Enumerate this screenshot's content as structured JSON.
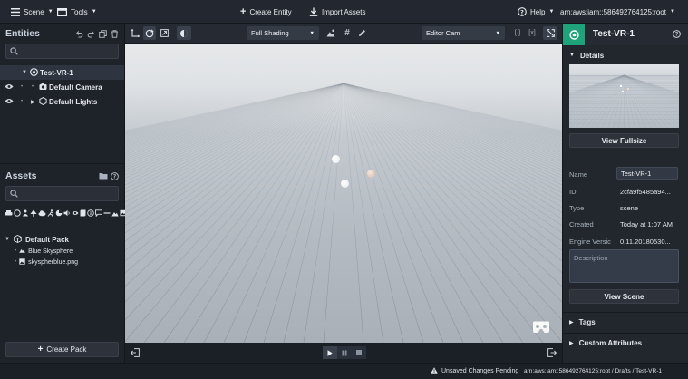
{
  "topbar": {
    "scene_menu": "Scene",
    "tools_menu": "Tools",
    "create_entity": "Create Entity",
    "import_assets": "Import Assets",
    "help_menu": "Help",
    "account_menu": "arn:aws:iam::586492764125:root"
  },
  "entities": {
    "title": "Entities",
    "search_placeholder": "",
    "tree": [
      {
        "label": "Test-VR-1"
      },
      {
        "label": "Default Camera"
      },
      {
        "label": "Default Lights"
      }
    ]
  },
  "assets": {
    "title": "Assets",
    "search_placeholder": "",
    "pack": "Default Pack",
    "items": [
      "Blue Skysphere",
      "skyspherblue.png"
    ],
    "create_pack": "Create Pack"
  },
  "viewport_toolbar": {
    "shading": "Full Shading",
    "camera": "Editor Cam"
  },
  "details": {
    "panel_title": "Test-VR-1",
    "section_title": "Details",
    "view_fullsize": "View Fullsize",
    "fields": [
      {
        "label": "Name",
        "value": "Test-VR-1"
      },
      {
        "label": "ID",
        "value": "2cfa9f5485a94..."
      },
      {
        "label": "Type",
        "value": "scene"
      },
      {
        "label": "Created",
        "value": "Today at 1:07 AM"
      },
      {
        "label": "Engine Versic",
        "value": "0.11.20180530..."
      }
    ],
    "description_placeholder": "Description",
    "view_scene": "View Scene",
    "tags": "Tags",
    "custom_attributes": "Custom Attributes"
  },
  "status": {
    "unsaved": "Unsaved Changes Pending",
    "breadcrumb": "arn:aws:iam::586492764125:root / Drafts / Test-VR-1"
  },
  "colors": {
    "accent_green": "#1fa37a",
    "background": "#1b1f26"
  }
}
